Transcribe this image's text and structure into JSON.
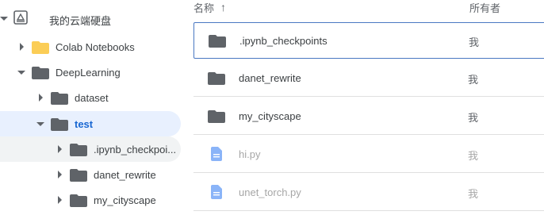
{
  "sidebar": {
    "root": {
      "label": "我的云端硬盘",
      "icon": "drive-icon"
    },
    "items": [
      {
        "label": "Colab Notebooks",
        "icon": "folder-yellow-icon",
        "color": "#fbcd56"
      },
      {
        "label": "DeepLearning",
        "icon": "folder-icon"
      },
      {
        "label": "dataset",
        "icon": "folder-icon"
      },
      {
        "label": "test",
        "icon": "folder-icon",
        "selected": true
      },
      {
        "label": ".ipynb_checkpoi...",
        "icon": "folder-icon"
      },
      {
        "label": "danet_rewrite",
        "icon": "folder-icon"
      },
      {
        "label": "my_cityscape",
        "icon": "folder-icon"
      }
    ]
  },
  "main": {
    "header": {
      "name": "名称",
      "sort_arrow": "↑",
      "owner": "所有者"
    },
    "rows": [
      {
        "name": ".ipynb_checkpoints",
        "owner": "我",
        "type": "folder"
      },
      {
        "name": "danet_rewrite",
        "owner": "我",
        "type": "folder"
      },
      {
        "name": "my_cityscape",
        "owner": "我",
        "type": "folder"
      },
      {
        "name": "hi.py",
        "owner": "我",
        "type": "file"
      },
      {
        "name": "unet_torch.py",
        "owner": "我",
        "type": "file"
      }
    ]
  },
  "colors": {
    "selection_bg": "#e8f0fe",
    "selection_text": "#1967d2",
    "folder": "#5f6368",
    "doc_icon": "#8ab4f8"
  }
}
